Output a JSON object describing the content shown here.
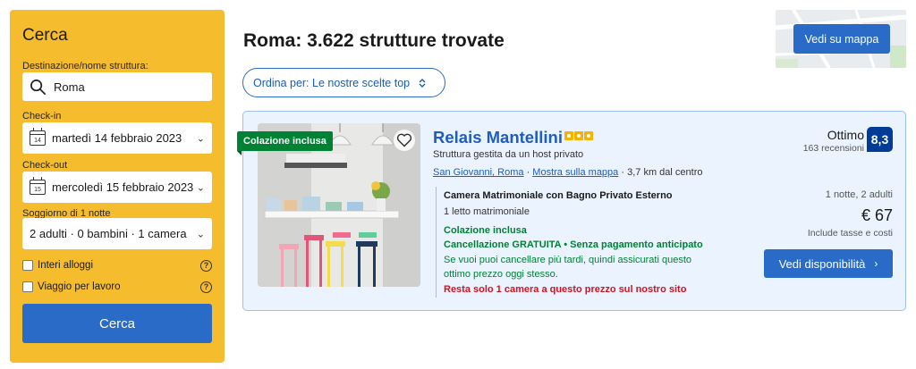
{
  "sidebar": {
    "title": "Cerca",
    "destination_label": "Destinazione/nome struttura:",
    "destination_value": "Roma",
    "checkin_label": "Check-in",
    "checkin_value": "martedì 14 febbraio 2023",
    "checkin_day": "14",
    "checkout_label": "Check-out",
    "checkout_value": "mercoledì 15 febbraio 2023",
    "checkout_day": "15",
    "stay_label": "Soggiorno di 1 notte",
    "guests_value": "2 adulti · 0 bambini · 1 camera",
    "check_entire": "Interi alloggi",
    "check_business": "Viaggio per lavoro",
    "help_glyph": "?",
    "search_button": "Cerca"
  },
  "header": {
    "results_title": "Roma: 3.622 strutture trovate",
    "sort_label": "Ordina per: Le nostre scelte top",
    "map_button": "Vedi su mappa"
  },
  "card": {
    "ribbon": "Colazione inclusa",
    "name": "Relais Mantellini",
    "stars": 3,
    "hosted": "Struttura gestita da un host privato",
    "area_link": "San Giovanni, Roma",
    "map_link": "Mostra sulla mappa",
    "distance": "3,7 km dal centro",
    "room_name": "Camera Matrimoniale con Bagno Privato Esterno",
    "room_bed": "1 letto matrimoniale",
    "breakfast": "Colazione inclusa",
    "cancellation": "Cancellazione GRATUITA • Senza pagamento anticipato",
    "cancellation_note": "Se vuoi puoi cancellare più tardi, quindi assicurati questo ottimo prezzo oggi stesso.",
    "scarcity": "Resta solo 1 camera a questo prezzo sul nostro sito",
    "rating_word": "Ottimo",
    "reviews": "163 recensioni",
    "score": "8,3",
    "nights_guests": "1 notte, 2 adulti",
    "price": "€ 67",
    "taxes": "Include tasse e costi",
    "availability_button": "Vedi disponibilità"
  },
  "colors": {
    "sidebar_bg": "#f5bd2e",
    "primary": "#2a6bc8",
    "link": "#1f5dbf",
    "green": "#008234",
    "red": "#d4111e",
    "score_bg": "#003b95"
  },
  "icons": [
    "search-icon",
    "calendar-icon",
    "chevron-down-icon",
    "help-icon",
    "sort-icon",
    "heart-icon",
    "star-icon",
    "chevron-right-icon"
  ]
}
